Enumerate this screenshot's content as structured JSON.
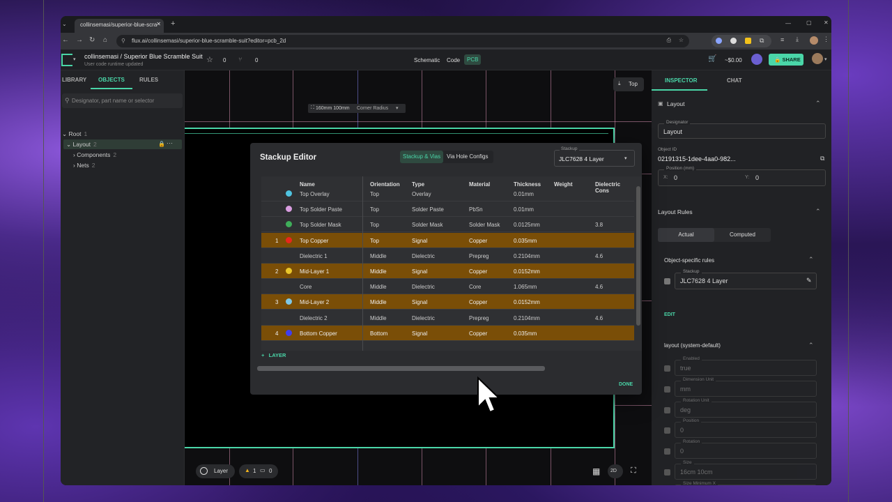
{
  "browser": {
    "tab_title": "collinsemasi/superior-blue-scra",
    "url": "flux.ai/collinsemasi/superior-blue-scramble-suit?editor=pcb_2d"
  },
  "header": {
    "project_title": "collinsemasi / Superior Blue Scramble Suit",
    "subtitle": "User code runtime updated",
    "star_count": "0",
    "fork_count": "0",
    "modes": [
      "Schematic",
      "Code",
      "PCB"
    ],
    "price": "~$0.00",
    "share_label": "SHARE"
  },
  "left_panel": {
    "tabs": [
      "LIBRARY",
      "OBJECTS",
      "RULES"
    ],
    "search_placeholder": "Designator, part name or selector",
    "tree": {
      "root": "Root",
      "root_count": "1",
      "layout": "Layout",
      "layout_count": "2",
      "components": "Components",
      "components_count": "2",
      "nets": "Nets",
      "nets_count": "2"
    }
  },
  "canvas": {
    "size_chip": "160mm 100mm",
    "corner_label": "Corner Radius",
    "side_button": "Top",
    "layer_button": "Layer",
    "warnings": "1",
    "comments": "0",
    "view_mode": "2D"
  },
  "stackup_editor": {
    "title": "Stackup Editor",
    "tabs": [
      "Stackup & Vias",
      "Via Hole Configs"
    ],
    "stackup_label": "Stackup",
    "stackup_value": "JLC7628 4 Layer",
    "columns": [
      "Name",
      "Orientation",
      "Type",
      "Material",
      "Thickness",
      "Weight",
      "Dielectric Cons"
    ],
    "rows": [
      {
        "num": "",
        "color": "#4fc3e0",
        "name": "Top Overlay",
        "orientation": "Top",
        "type": "Overlay",
        "material": "",
        "thickness": "0.01mm",
        "dielectric": "",
        "signal": false
      },
      {
        "num": "",
        "color": "#d99de0",
        "name": "Top Solder Paste",
        "orientation": "Top",
        "type": "Solder Paste",
        "material": "PbSn",
        "thickness": "0.01mm",
        "dielectric": "",
        "signal": false
      },
      {
        "num": "",
        "color": "#3fae5a",
        "name": "Top Solder Mask",
        "orientation": "Top",
        "type": "Solder Mask",
        "material": "Solder Mask",
        "thickness": "0.0125mm",
        "dielectric": "3.8",
        "signal": false
      },
      {
        "num": "1",
        "color": "#e8261c",
        "name": "Top Copper",
        "orientation": "Top",
        "type": "Signal",
        "material": "Copper",
        "thickness": "0.035mm",
        "dielectric": "",
        "signal": true
      },
      {
        "num": "",
        "color": "",
        "name": "Dielectric 1",
        "orientation": "Middle",
        "type": "Dielectric",
        "material": "Prepreg",
        "thickness": "0.2104mm",
        "dielectric": "4.6",
        "signal": false
      },
      {
        "num": "2",
        "color": "#e9c62a",
        "name": "Mid-Layer 1",
        "orientation": "Middle",
        "type": "Signal",
        "material": "Copper",
        "thickness": "0.0152mm",
        "dielectric": "",
        "signal": true
      },
      {
        "num": "",
        "color": "",
        "name": "Core",
        "orientation": "Middle",
        "type": "Dielectric",
        "material": "Core",
        "thickness": "1.065mm",
        "dielectric": "4.6",
        "signal": false
      },
      {
        "num": "3",
        "color": "#7fc8e6",
        "name": "Mid-Layer 2",
        "orientation": "Middle",
        "type": "Signal",
        "material": "Copper",
        "thickness": "0.0152mm",
        "dielectric": "",
        "signal": true
      },
      {
        "num": "",
        "color": "",
        "name": "Dielectric 2",
        "orientation": "Middle",
        "type": "Dielectric",
        "material": "Prepreg",
        "thickness": "0.2104mm",
        "dielectric": "4.6",
        "signal": false
      },
      {
        "num": "4",
        "color": "#3f3ef0",
        "name": "Bottom Copper",
        "orientation": "Bottom",
        "type": "Signal",
        "material": "Copper",
        "thickness": "0.035mm",
        "dielectric": "",
        "signal": true
      }
    ],
    "add_layer": "LAYER",
    "done": "DONE"
  },
  "inspector": {
    "tabs": [
      "INSPECTOR",
      "CHAT"
    ],
    "section": "Layout",
    "designator_label": "Designator",
    "designator_value": "Layout",
    "object_id_label": "Object ID",
    "object_id": "02191315-1dee-4aa0-982...",
    "position_label": "Position (mm)",
    "pos_x_label": "X:",
    "pos_x": "0",
    "pos_y_label": "Y:",
    "pos_y": "0",
    "layout_rules": "Layout Rules",
    "toggle": [
      "Actual",
      "Computed"
    ],
    "object_rules": "Object-specific rules",
    "stackup_label": "Stackup",
    "stackup_value": "JLC7628 4 Layer",
    "edit": "EDIT",
    "system_default": "layout (system-default)",
    "props": [
      {
        "label": "Enabled",
        "value": "true"
      },
      {
        "label": "Dimension Unit",
        "value": "mm"
      },
      {
        "label": "Rotation Unit",
        "value": "deg"
      },
      {
        "label": "Position",
        "value": "0"
      },
      {
        "label": "Rotation",
        "value": "0"
      },
      {
        "label": "Size",
        "value": "16cm 10cm"
      },
      {
        "label": "Size Minimum X",
        "value": "5mm"
      }
    ]
  },
  "colors": {
    "accent": "#4ad6a8",
    "signal_row": "#7a4e07",
    "board_outline": "#4ad6a8"
  }
}
